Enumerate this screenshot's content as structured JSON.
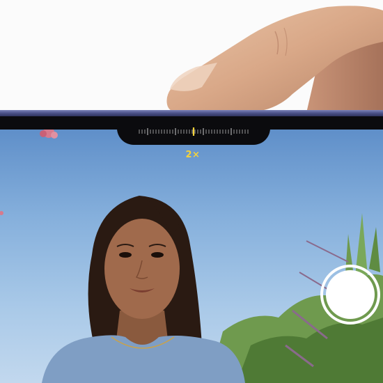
{
  "camera": {
    "zoom_level": "2×",
    "zoom_slider_position": 0.5
  },
  "colors": {
    "zoom_accent": "#f5d33a",
    "phone_frame": "#4b5188",
    "bezel": "#0b0b0e",
    "sky": "#86b0dc"
  },
  "icons": {
    "shutter": "shutter-button"
  }
}
